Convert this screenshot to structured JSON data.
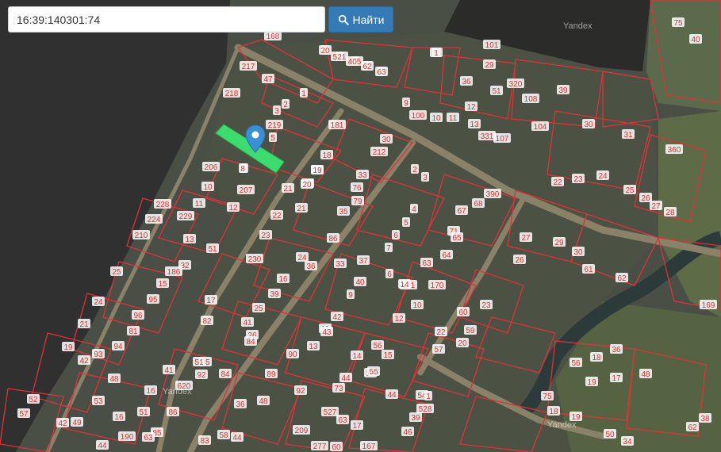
{
  "search": {
    "value": "16:39:140301:74",
    "button_label": "Найти",
    "button_icon": "search-icon"
  },
  "map": {
    "provider_watermark": "Yandex",
    "highlight_color": "#3cdc6e",
    "boundary_color": "#e0303a",
    "pin_color": "#3b8fd6",
    "parcel_labels": [
      "46",
      "3",
      "4",
      "5",
      "6",
      "7",
      "32",
      "101",
      "29",
      "217",
      "47",
      "1",
      "2",
      "8",
      "9",
      "36",
      "320",
      "51",
      "108",
      "39",
      "218",
      "3",
      "100",
      "10",
      "11",
      "12",
      "13",
      "331",
      "107",
      "104",
      "30",
      "219",
      "5",
      "181",
      "30",
      "212",
      "19",
      "31",
      "360",
      "206",
      "8",
      "18",
      "19",
      "33",
      "2",
      "3",
      "390",
      "68",
      "20",
      "21",
      "22",
      "23",
      "24",
      "25",
      "26",
      "27",
      "28",
      "10",
      "207",
      "20",
      "76",
      "79",
      "4",
      "67",
      "71",
      "228",
      "11",
      "21",
      "22",
      "35",
      "5",
      "65",
      "27",
      "29",
      "224",
      "229",
      "12",
      "23",
      "6",
      "86",
      "7",
      "63",
      "64",
      "26",
      "30",
      "210",
      "13",
      "230",
      "24",
      "36",
      "37",
      "6",
      "171",
      "170",
      "61",
      "62",
      "51",
      "32",
      "33",
      "14",
      "25",
      "186",
      "15",
      "16",
      "39",
      "40",
      "9",
      "10",
      "60",
      "23",
      "24",
      "95",
      "17",
      "25",
      "41",
      "42",
      "11",
      "12",
      "59",
      "22",
      "21",
      "96",
      "81",
      "82",
      "26",
      "43",
      "13",
      "14",
      "56",
      "57",
      "20",
      "19",
      "94",
      "93",
      "84",
      "90",
      "15",
      "16",
      "25",
      "42",
      "41",
      "51",
      "92",
      "89",
      "44",
      "73",
      "55",
      "54",
      "56",
      "18",
      "36",
      "48",
      "620",
      "84",
      "92",
      "1",
      "528",
      "44",
      "17",
      "75",
      "19",
      "17",
      "16",
      "51",
      "86",
      "36",
      "48",
      "209",
      "527",
      "46",
      "19",
      "18",
      "52",
      "53",
      "16",
      "44",
      "85",
      "83",
      "58",
      "277",
      "60",
      "42",
      "190",
      "167",
      "169",
      "34",
      "50",
      "63",
      "57",
      "49",
      "44",
      "63",
      "39",
      "40",
      "75",
      "38",
      "62",
      "48",
      "168",
      "20",
      "521",
      "405",
      "62",
      "63",
      "1"
    ]
  }
}
